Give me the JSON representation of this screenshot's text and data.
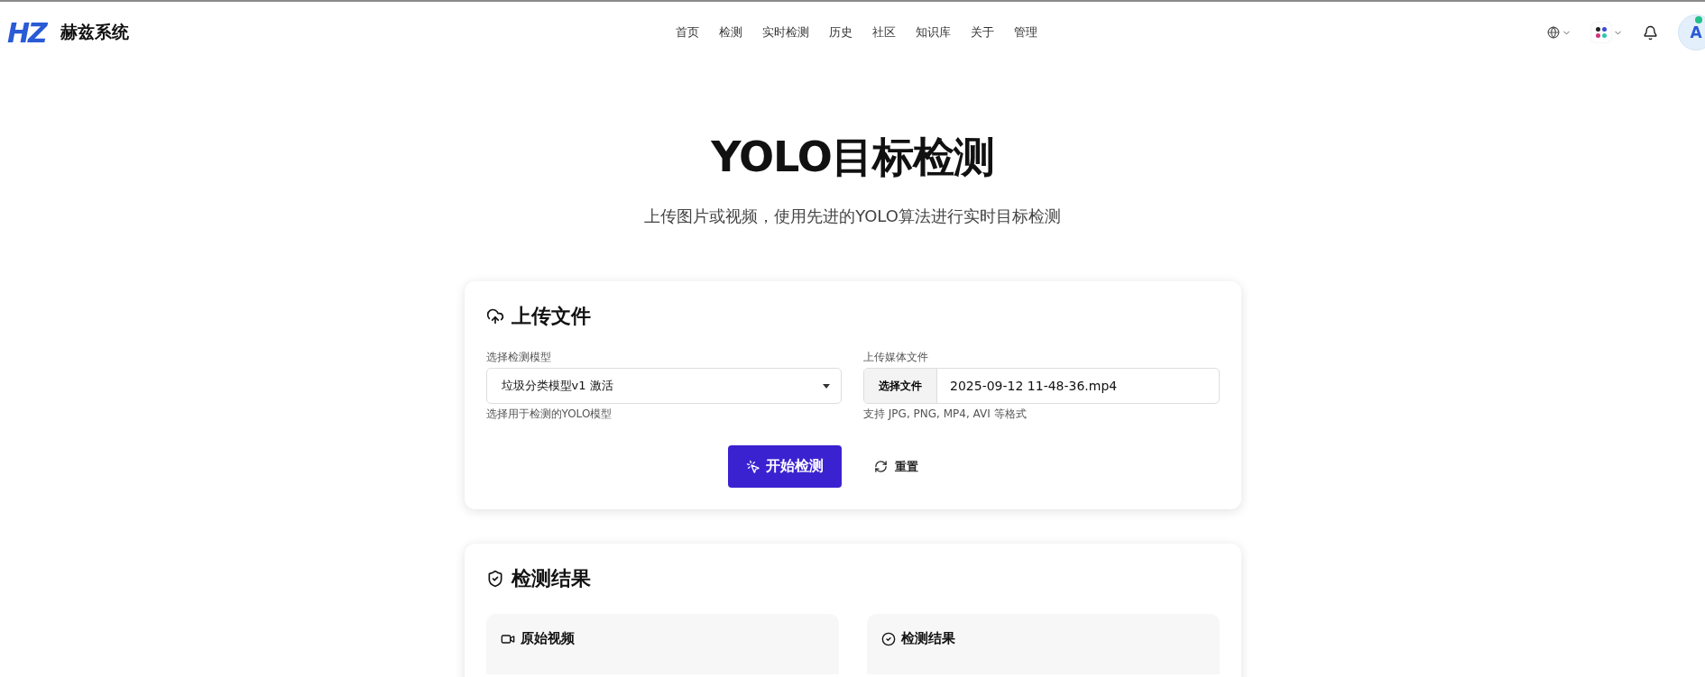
{
  "header": {
    "logo": "HZ",
    "brand": "赫兹系统",
    "nav": [
      {
        "label": "首页",
        "selected": false
      },
      {
        "label": "检测",
        "selected": false
      },
      {
        "label": "实时检测",
        "selected": false
      },
      {
        "label": "历史",
        "selected": false
      },
      {
        "label": "社区",
        "selected": false
      },
      {
        "label": "知识库",
        "selected": false
      },
      {
        "label": "关于",
        "selected": false
      },
      {
        "label": "管理",
        "selected": false
      }
    ],
    "avatar": "A",
    "avatar_online": true
  },
  "hero": {
    "title": "YOLO目标检测",
    "subtitle": "上传图片或视频，使用先进的YOLO算法进行实时目标检测"
  },
  "upload": {
    "title": "上传文件",
    "model": {
      "label": "选择检测模型",
      "value": "垃圾分类模型v1 激活",
      "help": "选择用于检测的YOLO模型"
    },
    "file": {
      "label": "上传媒体文件",
      "button": "选择文件",
      "value": "2025-09-12 11-48-36.mp4",
      "help": "支持 JPG, PNG, MP4, AVI 等格式"
    },
    "start_button": "开始检测",
    "reset_button": "重置"
  },
  "results": {
    "title": "检测结果",
    "panels": [
      {
        "kind": "video",
        "title": "原始视频"
      },
      {
        "kind": "result",
        "title": "检测结果"
      }
    ]
  }
}
